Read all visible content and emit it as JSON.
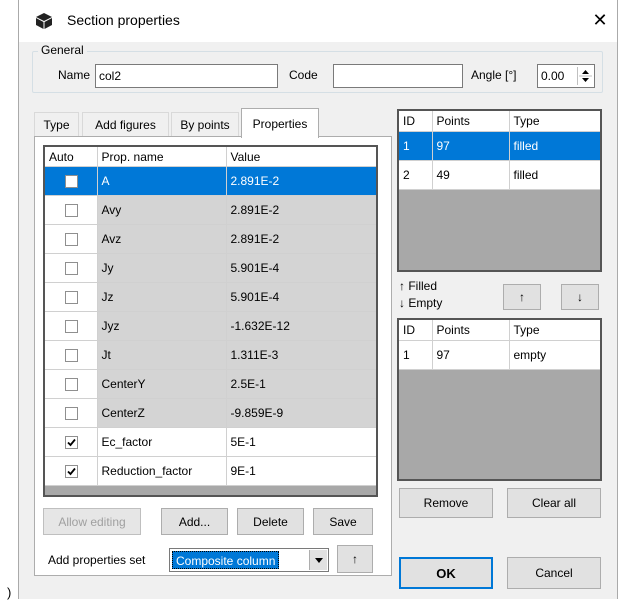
{
  "window": {
    "title": "Section properties",
    "close_glyph": "✕"
  },
  "general": {
    "legend": "General",
    "name_label": "Name",
    "name_value": "col2",
    "code_label": "Code",
    "code_value": "",
    "angle_label": "Angle [°]",
    "angle_value": "0.00"
  },
  "tabs": [
    {
      "label": "Type"
    },
    {
      "label": "Add figures"
    },
    {
      "label": "By points"
    },
    {
      "label": "Properties"
    }
  ],
  "properties_table": {
    "headers": {
      "auto": "Auto",
      "name": "Prop. name",
      "value": "Value"
    },
    "rows": [
      {
        "checked": false,
        "name": "A",
        "value": "2.891E-2"
      },
      {
        "checked": false,
        "name": "Avy",
        "value": "2.891E-2"
      },
      {
        "checked": false,
        "name": "Avz",
        "value": "2.891E-2"
      },
      {
        "checked": false,
        "name": "Jy",
        "value": "5.901E-4"
      },
      {
        "checked": false,
        "name": "Jz",
        "value": "5.901E-4"
      },
      {
        "checked": false,
        "name": "Jyz",
        "value": "-1.632E-12"
      },
      {
        "checked": false,
        "name": "Jt",
        "value": "1.311E-3"
      },
      {
        "checked": false,
        "name": "CenterY",
        "value": "2.5E-1"
      },
      {
        "checked": false,
        "name": "CenterZ",
        "value": "-9.859E-9"
      },
      {
        "checked": true,
        "name": "Ec_factor",
        "value": "5E-1"
      },
      {
        "checked": true,
        "name": "Reduction_factor",
        "value": "9E-1"
      }
    ]
  },
  "prop_buttons": {
    "allow_editing": "Allow editing",
    "add": "Add...",
    "delete": "Delete",
    "save": "Save"
  },
  "properties_set": {
    "label": "Add properties set",
    "selected": "Composite column",
    "up": "↑"
  },
  "filled_table": {
    "headers": {
      "id": "ID",
      "points": "Points",
      "type": "Type"
    },
    "rows": [
      {
        "id": "1",
        "points": "97",
        "type": "filled"
      },
      {
        "id": "2",
        "points": "49",
        "type": "filled"
      }
    ]
  },
  "move": {
    "filled_label": "↑ Filled",
    "empty_label": "↓ Empty",
    "up": "↑",
    "down": "↓"
  },
  "empty_table": {
    "headers": {
      "id": "ID",
      "points": "Points",
      "type": "Type"
    },
    "rows": [
      {
        "id": "1",
        "points": "97",
        "type": "empty"
      }
    ]
  },
  "side_buttons": {
    "remove": "Remove",
    "clear_all": "Clear all",
    "ok": "OK",
    "cancel": "Cancel"
  },
  "edge_glyph": ")",
  "colors": {
    "selection": "#0078d7",
    "window_bg": "#f0f0f0",
    "grid_empty": "#a8a8a8"
  }
}
